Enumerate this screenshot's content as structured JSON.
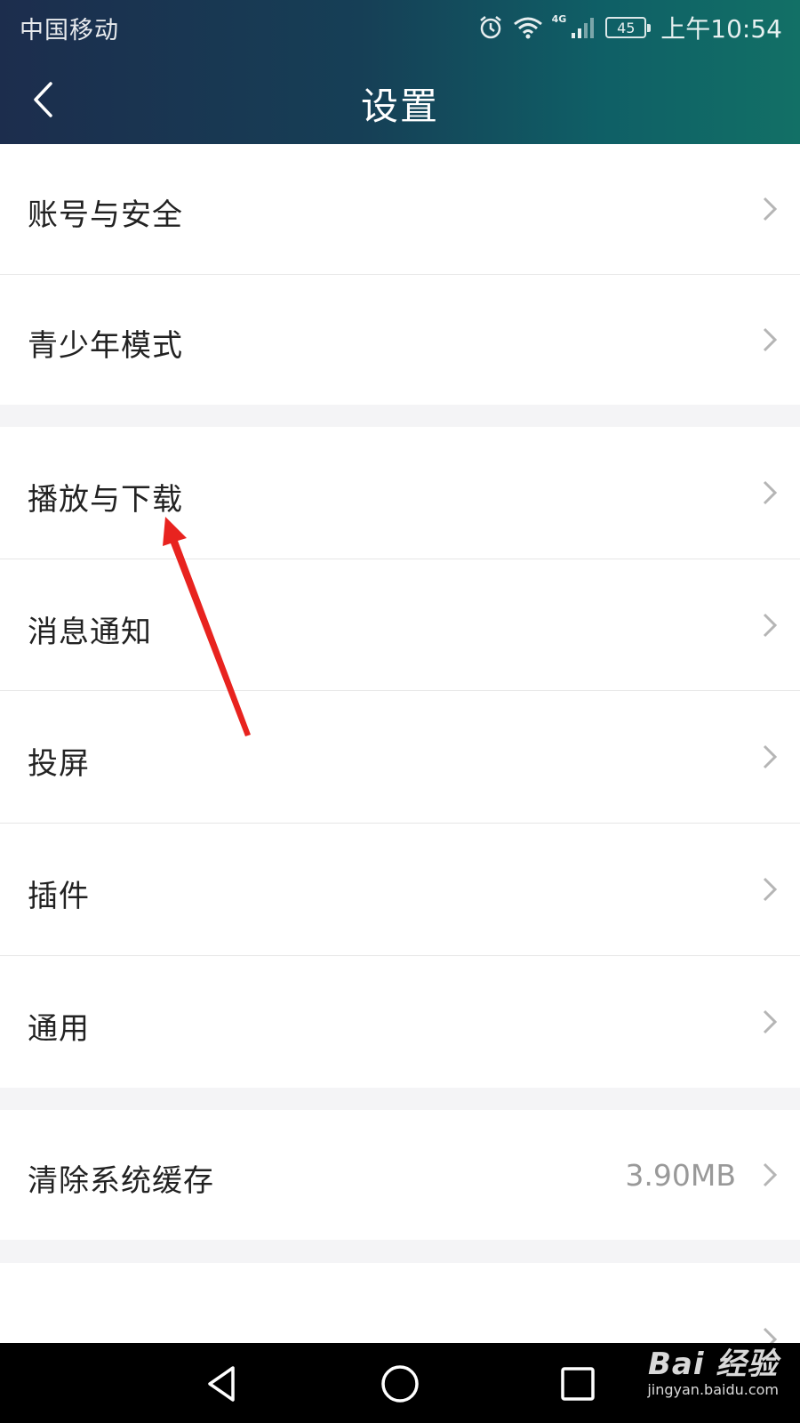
{
  "status_bar": {
    "carrier": "中国移动",
    "network": "4G",
    "battery": "45",
    "time": "上午10:54"
  },
  "header": {
    "title": "设置"
  },
  "settings": {
    "items": [
      {
        "label": "账号与安全"
      },
      {
        "label": "青少年模式"
      },
      {
        "label": "播放与下载"
      },
      {
        "label": "消息通知"
      },
      {
        "label": "投屏"
      },
      {
        "label": "插件"
      },
      {
        "label": "通用"
      },
      {
        "label": "清除系统缓存",
        "value": "3.90MB"
      }
    ]
  },
  "watermark": {
    "brand": "Bai 经验",
    "url": "jingyan.baidu.com"
  },
  "colors": {
    "header_start": "#1c2d4d",
    "header_end": "#127066",
    "annotation_arrow": "#e8231f",
    "page_background": "#f4f4f6"
  }
}
